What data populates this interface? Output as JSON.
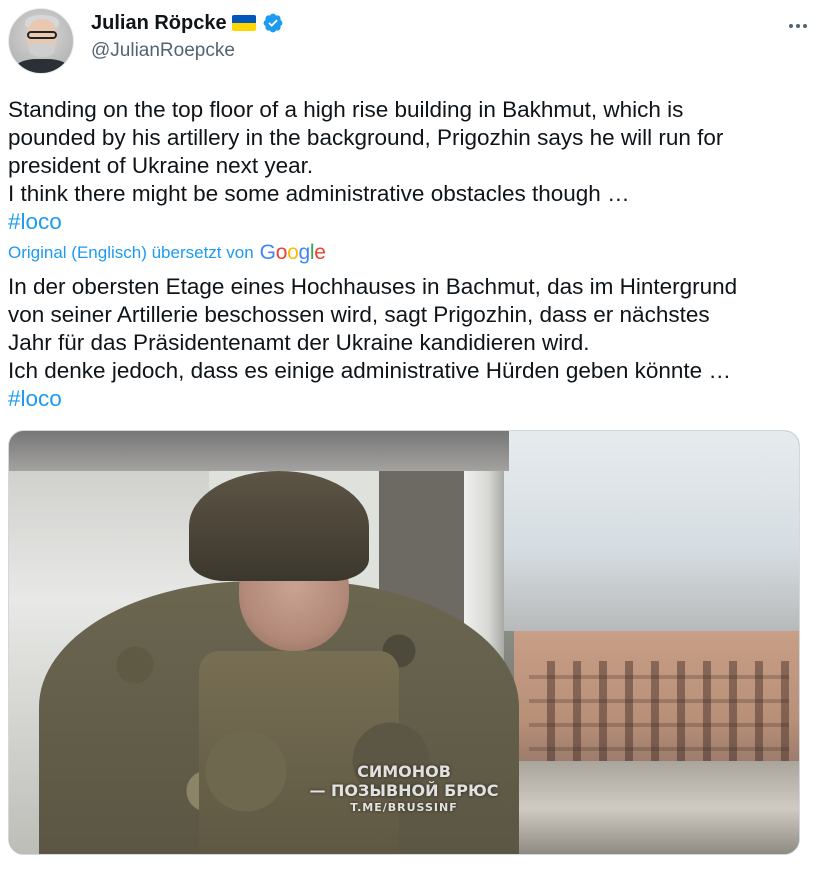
{
  "author": {
    "display_name": "Julian Röpcke",
    "handle": "@JulianRoepcke",
    "flag_icon": "ukraine-flag-icon",
    "verified_icon": "verified-badge-icon",
    "verified_color": "#1d9bf0"
  },
  "menu": {
    "more_icon": "more-horizontal-icon"
  },
  "tweet": {
    "lines": [
      "Standing on the top floor of a high rise building in Bakhmut, which is",
      "pounded by his artillery in the background, Prigozhin says he will run for",
      "president of Ukraine next year.",
      "I think there might be some administrative obstacles though …"
    ],
    "hashtag": "#loco"
  },
  "translation": {
    "note": "Original (Englisch) übersetzt von",
    "provider": "Google",
    "lines": [
      "In der obersten Etage eines Hochhauses in Bachmut, das im Hintergrund",
      "von seiner Artillerie beschossen wird, sagt Prigozhin, dass er nächstes",
      "Jahr für das Präsidentenamt der Ukraine kandidieren wird.",
      "Ich denke jedoch, dass es einige administrative Hürden geben könnte …"
    ],
    "hashtag": "#loco"
  },
  "media": {
    "caption_line1": "СИМОНОВ",
    "caption_line2": "— ПОЗЫВНОЙ БРЮС",
    "caption_line3": "T.ME/BRUSSINF"
  },
  "colors": {
    "text": "#0f1419",
    "secondary": "#536471",
    "link": "#1d9bf0"
  }
}
